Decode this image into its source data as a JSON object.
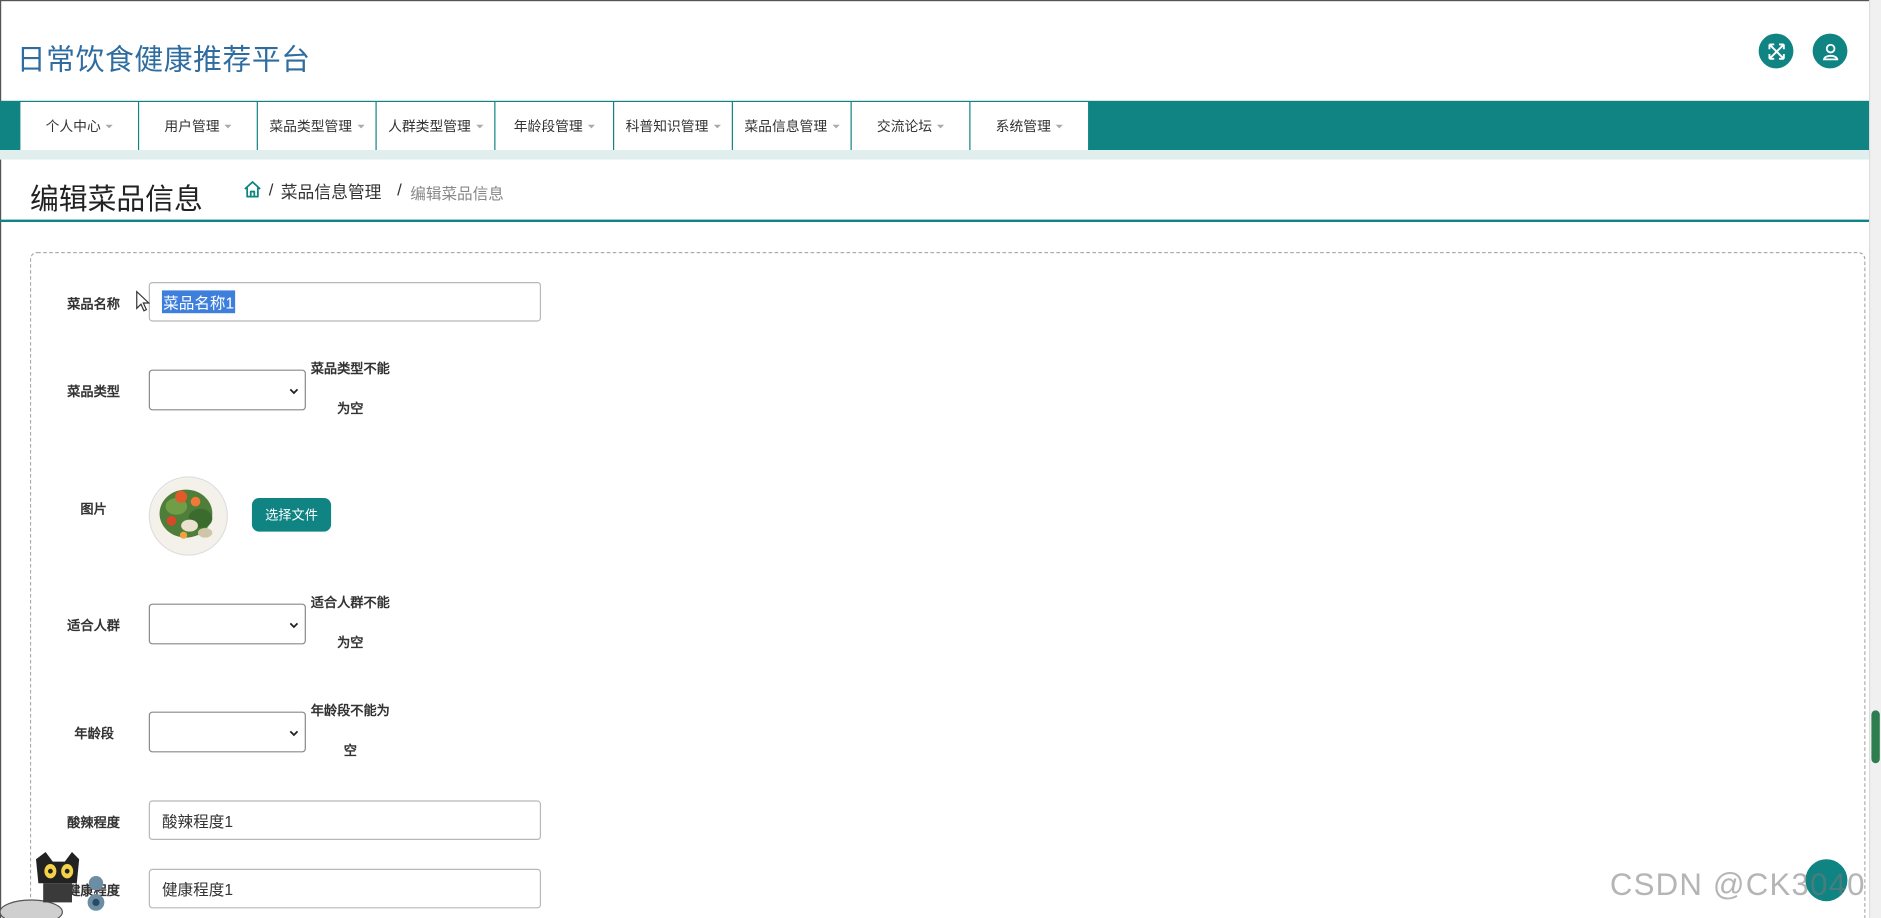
{
  "app": {
    "title": "日常饮食健康推荐平台"
  },
  "header_buttons": [
    {
      "name": "fullscreen",
      "icon": "expand-arrows-icon"
    },
    {
      "name": "user",
      "icon": "user-icon"
    }
  ],
  "nav": {
    "items": [
      {
        "label": "个人中心"
      },
      {
        "label": "用户管理"
      },
      {
        "label": "菜品类型管理"
      },
      {
        "label": "人群类型管理"
      },
      {
        "label": "年龄段管理"
      },
      {
        "label": "科普知识管理"
      },
      {
        "label": "菜品信息管理"
      },
      {
        "label": "交流论坛"
      },
      {
        "label": "系统管理"
      }
    ]
  },
  "page": {
    "title": "编辑菜品信息",
    "breadcrumb": {
      "sep": "/",
      "parent": "菜品信息管理",
      "current": "编辑菜品信息"
    }
  },
  "form": {
    "name": {
      "label": "菜品名称",
      "value": "菜品名称1"
    },
    "dish_type": {
      "label": "菜品类型",
      "value": "",
      "error_line1": "菜品类型不能",
      "error_line2": "为空"
    },
    "image": {
      "label": "图片",
      "button": "选择文件"
    },
    "crowd": {
      "label": "适合人群",
      "value": "",
      "error_line1": "适合人群不能",
      "error_line2": "为空"
    },
    "age_group": {
      "label": "年龄段",
      "value": "",
      "error_line1": "年龄段不能为",
      "error_line2": "空"
    },
    "spicy": {
      "label": "酸辣程度",
      "value": "酸辣程度1"
    },
    "health": {
      "label": "健康程度",
      "value": "健康程度1"
    }
  },
  "watermark": "CSDN @CK3040",
  "colors": {
    "primary": "#0f8483",
    "title_blue": "#2f6c9f",
    "nav_under": "#e0efee"
  }
}
